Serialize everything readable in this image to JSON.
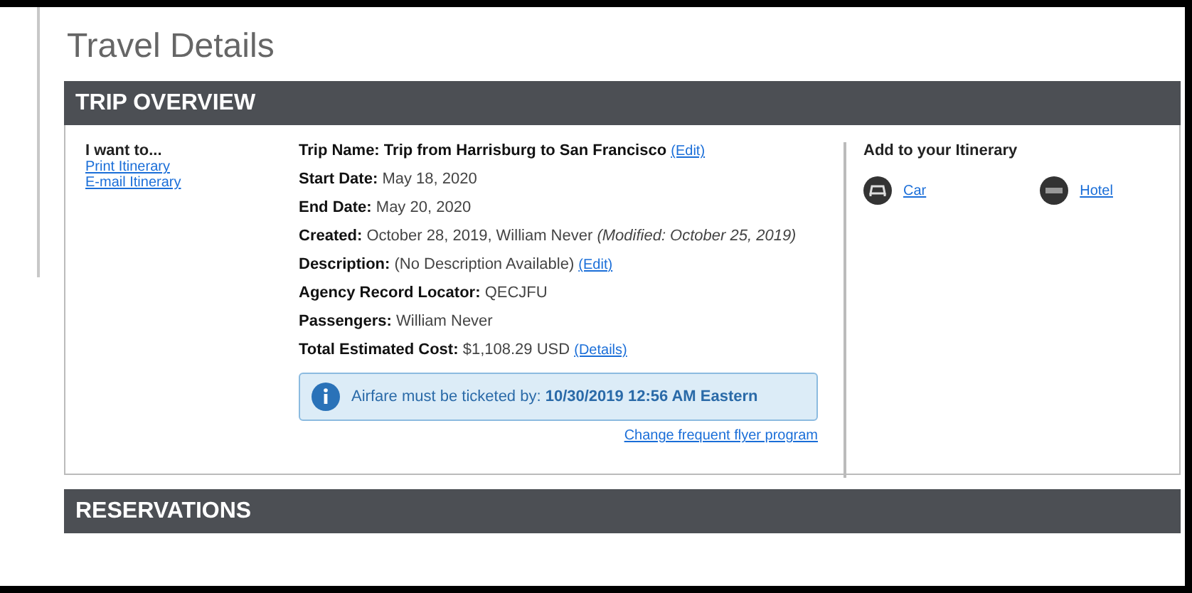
{
  "page_title": "Travel Details",
  "trip_overview": {
    "heading": "TRIP OVERVIEW",
    "actions": {
      "heading": "I want to...",
      "links": [
        "Print Itinerary",
        "E-mail Itinerary"
      ]
    },
    "fields": [
      {
        "label": "Trip Name:",
        "value": "Trip from Harrisburg to San Francisco",
        "link": "(Edit)",
        "bold_value": true
      },
      {
        "label": "Start Date:",
        "value": "May 18, 2020"
      },
      {
        "label": "End Date:",
        "value": "May 20, 2020"
      },
      {
        "label": "Created:",
        "value": "October 28, 2019, William Never *(Modified: October 25, 2019)*"
      },
      {
        "label": "Description:",
        "value": "(No Description Available)",
        "link": "(Edit)"
      },
      {
        "label": "Agency Record Locator:",
        "value": "QECJFU"
      },
      {
        "label": "Passengers:",
        "value": "William Never"
      },
      {
        "label": "Total Estimated Cost:",
        "value": "$1,108.29 USD",
        "link": "(Details)"
      }
    ],
    "notice": {
      "text": "Airfare must be ticketed by: **10/30/2019 12:56 AM Eastern**"
    },
    "notice_link": "Change frequent flyer program",
    "add": {
      "heading": "Add to your Itinerary",
      "items": [
        {
          "kind": "car",
          "label": "Car"
        },
        {
          "kind": "hotel",
          "label": "Hotel"
        }
      ]
    }
  },
  "reservations": {
    "heading": "RESERVATIONS"
  }
}
